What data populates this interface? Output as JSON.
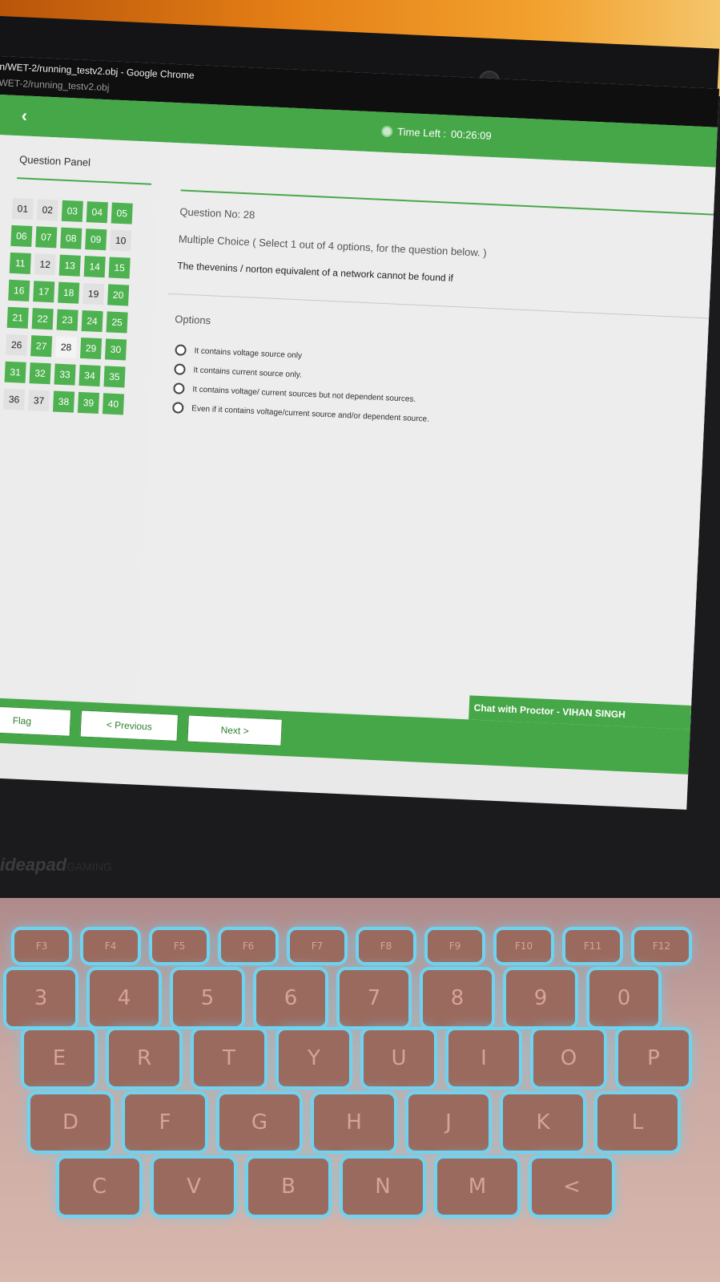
{
  "browser": {
    "title": "n/WET-2/running_testv2.obj - Google Chrome",
    "url": "WET-2/running_testv2.obj"
  },
  "header": {
    "back_icon": "chevron-left-icon",
    "timer_label": "Time Left :",
    "timer_value": "00:26:09"
  },
  "question_panel": {
    "title": "Question Panel",
    "items": [
      {
        "label": "01",
        "state": "unvisited"
      },
      {
        "label": "02",
        "state": "unvisited"
      },
      {
        "label": "03",
        "state": "answered"
      },
      {
        "label": "04",
        "state": "answered"
      },
      {
        "label": "05",
        "state": "answered"
      },
      {
        "label": "06",
        "state": "answered"
      },
      {
        "label": "07",
        "state": "answered"
      },
      {
        "label": "08",
        "state": "answered"
      },
      {
        "label": "09",
        "state": "answered"
      },
      {
        "label": "10",
        "state": "unvisited"
      },
      {
        "label": "11",
        "state": "answered"
      },
      {
        "label": "12",
        "state": "unvisited"
      },
      {
        "label": "13",
        "state": "answered"
      },
      {
        "label": "14",
        "state": "answered"
      },
      {
        "label": "15",
        "state": "answered"
      },
      {
        "label": "16",
        "state": "answered"
      },
      {
        "label": "17",
        "state": "answered"
      },
      {
        "label": "18",
        "state": "answered"
      },
      {
        "label": "19",
        "state": "unvisited"
      },
      {
        "label": "20",
        "state": "answered"
      },
      {
        "label": "21",
        "state": "answered"
      },
      {
        "label": "22",
        "state": "answered"
      },
      {
        "label": "23",
        "state": "answered"
      },
      {
        "label": "24",
        "state": "answered"
      },
      {
        "label": "25",
        "state": "answered"
      },
      {
        "label": "26",
        "state": "unvisited"
      },
      {
        "label": "27",
        "state": "answered"
      },
      {
        "label": "28",
        "state": "current"
      },
      {
        "label": "29",
        "state": "answered"
      },
      {
        "label": "30",
        "state": "answered"
      },
      {
        "label": "31",
        "state": "answered"
      },
      {
        "label": "32",
        "state": "answered"
      },
      {
        "label": "33",
        "state": "answered"
      },
      {
        "label": "34",
        "state": "answered"
      },
      {
        "label": "35",
        "state": "answered"
      },
      {
        "label": "36",
        "state": "unvisited"
      },
      {
        "label": "37",
        "state": "unvisited"
      },
      {
        "label": "38",
        "state": "answered"
      },
      {
        "label": "39",
        "state": "answered"
      },
      {
        "label": "40",
        "state": "answered"
      }
    ]
  },
  "question": {
    "number_label": "Question No: 28",
    "type_label": "Multiple Choice ( Select 1 out of 4 options, for the question below. )",
    "text": "The thevenins / norton equivalent of a network cannot be found if",
    "options_title": "Options",
    "options": [
      "It contains voltage source only",
      "It contains current source only.",
      "It contains voltage/ current sources but not dependent sources.",
      "Even if it contains voltage/current source and/or dependent source."
    ]
  },
  "footer": {
    "chat_label": "Chat with Proctor - VIHAN SINGH",
    "flag_label": "Flag",
    "previous_label": "< Previous",
    "next_label": "Next >"
  },
  "laptop": {
    "brand": "ideapad",
    "brand_suffix": "GAMING"
  },
  "keyboard": {
    "row1": [
      "F3",
      "F4",
      "F5",
      "F6",
      "F7",
      "F8",
      "F9",
      "F10",
      "F11",
      "F12"
    ],
    "row2": [
      "3",
      "4",
      "5",
      "6",
      "7",
      "8",
      "9",
      "0"
    ],
    "row3": [
      "E",
      "R",
      "T",
      "Y",
      "U",
      "I",
      "O",
      "P"
    ],
    "row4": [
      "D",
      "F",
      "G",
      "H",
      "J",
      "K",
      "L"
    ],
    "row5": [
      "C",
      "V",
      "B",
      "N",
      "M",
      "<"
    ]
  },
  "colors": {
    "accent": "#46a748",
    "answered": "#4eb250",
    "key_glow": "#6fd3f0"
  }
}
